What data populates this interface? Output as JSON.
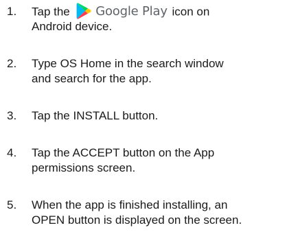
{
  "steps": [
    {
      "number": "1.",
      "pre": "Tap the",
      "brand": "Google Play",
      "post": "icon on",
      "line2": "Android device.",
      "icon": "google-play-icon"
    },
    {
      "number": "2.",
      "line1": "Type OS Home in the search window",
      "line2": "and search for the app."
    },
    {
      "number": "3.",
      "line1": "Tap the INSTALL button."
    },
    {
      "number": "4.",
      "line1": "Tap the ACCEPT button on the App",
      "line2": "permissions screen."
    },
    {
      "number": "5.",
      "line1": "When the app is finished installing, an",
      "line2": "OPEN button is displayed on the screen."
    }
  ],
  "colors": {
    "text": "#1a1a1a",
    "brand_text": "#5f6368",
    "play_green": "#00d46a",
    "play_blue": "#00b9f2",
    "play_yellow": "#ffc400",
    "play_red": "#ff3b4e"
  }
}
